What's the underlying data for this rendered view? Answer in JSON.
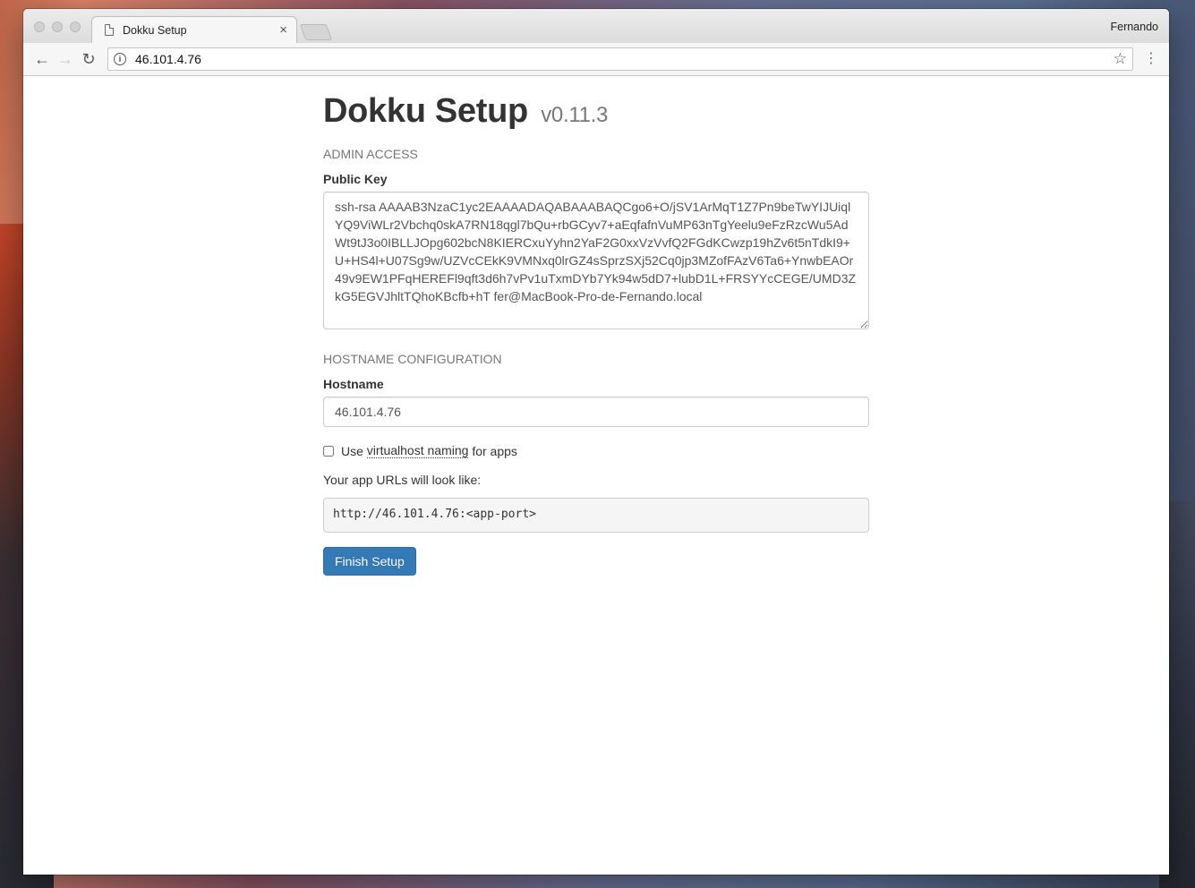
{
  "browser": {
    "tab_title": "Dokku Setup",
    "tab_close": "×",
    "profile_name": "Fernando",
    "url": "46.101.4.76"
  },
  "page": {
    "title": "Dokku Setup",
    "version": "v0.11.3",
    "admin_section": "ADMIN ACCESS",
    "public_key_label": "Public Key",
    "public_key_value": "ssh-rsa AAAAB3NzaC1yc2EAAAADAQABAAABAQCgo6+O/jSV1ArMqT1Z7Pn9beTwYIJUiqlYQ9ViWLr2Vbchq0skA7RN18qgl7bQu+rbGCyv7+aEqfafnVuMP63nTgYeelu9eFzRzcWu5AdWt9tJ3o0IBLLJOpg602bcN8KIERCxuYyhn2YaF2G0xxVzVvfQ2FGdKCwzp19hZv6t5nTdkI9+U+HS4l+U07Sg9w/UZVcCEkK9VMNxq0lrGZ4sSprzSXj52Cq0jp3MZofFAzV6Ta6+YnwbEAOr49v9EW1PFqHEREFl9qft3d6h7vPv1uTxmDYb7Yk94w5dD7+lubD1L+FRSYYcCEGE/UMD3ZkG5EGVJhltTQhoKBcfb+hT fer@MacBook-Pro-de-Fernando.local",
    "hostname_section": "HOSTNAME CONFIGURATION",
    "hostname_label": "Hostname",
    "hostname_value": "46.101.4.76",
    "vhost_prefix": "Use ",
    "vhost_link": "virtualhost naming",
    "vhost_suffix": " for apps",
    "url_note": "Your app URLs will look like:",
    "url_preview": "http://46.101.4.76:<app-port>",
    "finish_button": "Finish Setup"
  },
  "colors": {
    "primary": "#337ab7",
    "muted": "#777777"
  }
}
